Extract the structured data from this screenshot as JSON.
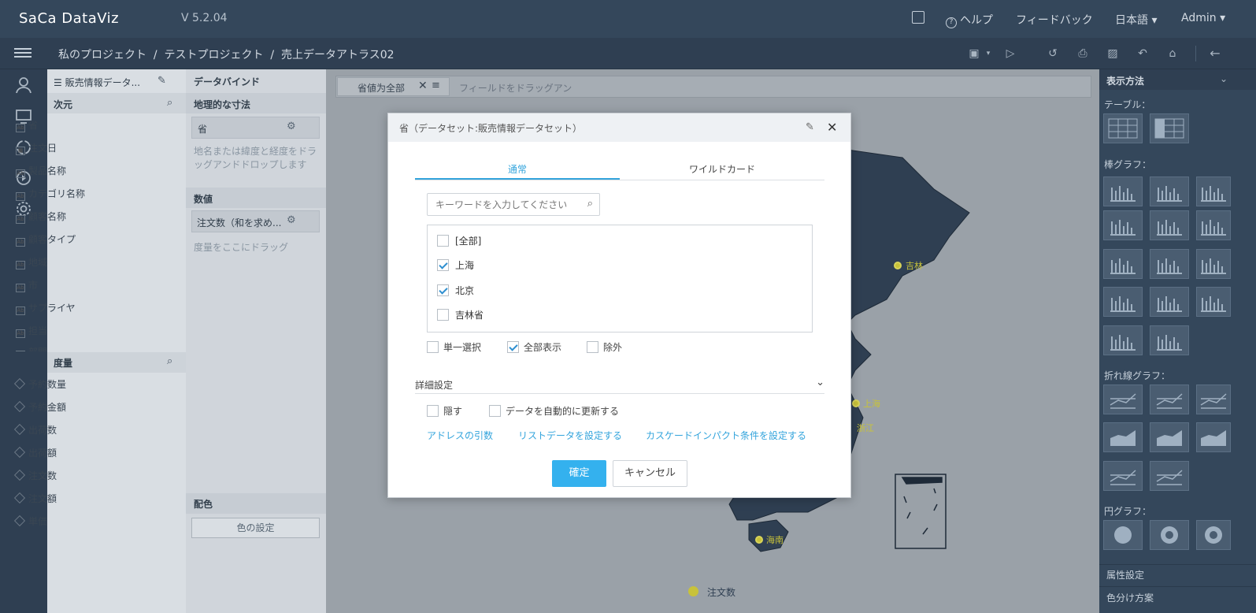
{
  "app": {
    "logo": "SaCa DataViz",
    "version": "V 5.2.04"
  },
  "topnav": {
    "help": "ヘルプ",
    "feedback": "フィードバック",
    "language": "日本語 ▾",
    "user": "Admin ▾"
  },
  "breadcrumb": "私のプロジェクト  /  テストプロジェクト  /  売上データアトラス02",
  "fields_panel": {
    "dataset": "販売情報データ...",
    "dimension_title": "次元",
    "dimensions": [
      "省",
      "注文日",
      "製品名称",
      "カテゴリ名称",
      "顧客名称",
      "顧客タイプ",
      "地域",
      "市",
      "サプライヤ",
      "担当",
      "部門"
    ],
    "measure_title": "度量",
    "measures": [
      "予約数量",
      "予約金額",
      "出荷数",
      "出荷額",
      "注文数",
      "注文額",
      "単価"
    ]
  },
  "bind_panel": {
    "title": "データバインド",
    "geo_title": "地理的な寸法",
    "geo_field": "省",
    "geo_hint": "地名または緯度と経度をドラッグアンドドロップします",
    "value_title": "数値",
    "value_field": "注文数（和を求め...",
    "value_hint": "度量をここにドラッグ",
    "color_title": "配色",
    "color_button": "色の設定"
  },
  "canvas": {
    "filter_chip": "省値为全部",
    "filter_hint": "フィールドをドラッグアン",
    "map_labels": [
      "吉林",
      "上海",
      "浙江",
      "海南"
    ],
    "legend": "注文数",
    "colors": {
      "map_land": "#2f3f52",
      "accent_dot": "#c8c23a"
    }
  },
  "right_panel": {
    "title": "表示方法",
    "sections": [
      "テーブル：",
      "棒グラフ：",
      "折れ線グラフ：",
      "円グラフ："
    ],
    "bottom": [
      "属性設定",
      "色分け方案"
    ]
  },
  "dialog": {
    "title": "省（データセット:販売情報データセット）",
    "tabs": [
      "通常",
      "ワイルドカード"
    ],
    "search_placeholder": "キーワードを入力してください",
    "items": [
      {
        "label": "[全部]",
        "checked": false
      },
      {
        "label": "上海",
        "checked": true
      },
      {
        "label": "北京",
        "checked": true
      },
      {
        "label": "吉林省",
        "checked": false
      }
    ],
    "options": [
      {
        "label": "単一選択",
        "checked": false
      },
      {
        "label": "全部表示",
        "checked": true
      },
      {
        "label": "除外",
        "checked": false
      }
    ],
    "advanced": "詳細設定",
    "advanced_options": [
      {
        "label": "隠す",
        "checked": false
      },
      {
        "label": "データを自動的に更新する",
        "checked": false
      }
    ],
    "links": [
      "アドレスの引数",
      "リストデータを設定する",
      "カスケードインパクト条件を設定する"
    ],
    "ok": "確定",
    "cancel": "キャンセル",
    "accent_color": "#34b1ee"
  }
}
